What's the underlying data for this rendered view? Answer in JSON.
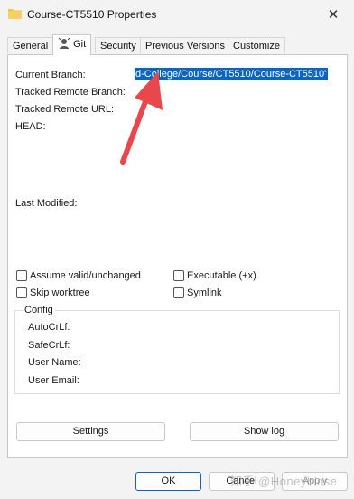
{
  "window": {
    "title": "Course-CT5510 Properties",
    "close_glyph": "✕"
  },
  "tabs": [
    {
      "label": "General"
    },
    {
      "label": "Git"
    },
    {
      "label": "Security"
    },
    {
      "label": "Previous Versions"
    },
    {
      "label": "Customize"
    }
  ],
  "git": {
    "current_branch_label": "Current Branch:",
    "current_branch_value": "d-College/Course/CT5510/Course-CT5510'",
    "tracked_remote_branch_label": "Tracked Remote Branch:",
    "tracked_remote_url_label": "Tracked Remote URL:",
    "head_label": "HEAD:",
    "last_modified_label": "Last Modified:"
  },
  "options": {
    "assume_valid": "Assume valid/unchanged",
    "executable": "Executable (+x)",
    "skip_worktree": "Skip worktree",
    "symlink": "Symlink"
  },
  "config": {
    "title": "Config",
    "autocrlf": "AutoCrLf:",
    "safecrlf": "SafeCrLf:",
    "user_name": "User Name:",
    "user_email": "User Email:"
  },
  "buttons": {
    "settings": "Settings",
    "show_log": "Show log",
    "ok": "OK",
    "cancel": "Cancel",
    "apply": "Apply"
  },
  "watermark": "知乎 @Honeybiose",
  "colors": {
    "selection": "#0a64c2",
    "arrow": "#e8484c",
    "folder": "#f4c542"
  }
}
